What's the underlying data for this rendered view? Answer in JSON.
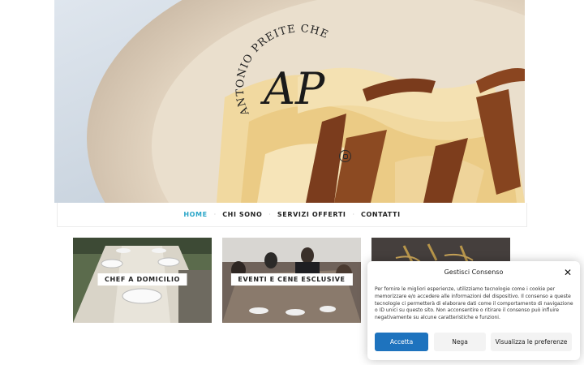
{
  "brand": {
    "logo_arc_text": "ANTONIO PREITE CHEF",
    "monogram": "AP"
  },
  "social": {
    "icon": "instagram-icon"
  },
  "nav": {
    "items": [
      {
        "label": "HOME",
        "active": true
      },
      {
        "label": "CHI SONO",
        "active": false
      },
      {
        "label": "SERVIZI OFFERTI",
        "active": false
      },
      {
        "label": "CONTATTI",
        "active": false
      }
    ],
    "separator": "·",
    "active_color": "#2aa6c8"
  },
  "cards": [
    {
      "label": "CHEF A DOMICILIO"
    },
    {
      "label": "EVENTI E CENE ESCLUSIVE"
    },
    {
      "label": ""
    }
  ],
  "cookie": {
    "title": "Gestisci Consenso",
    "close_icon": "close-icon",
    "text": "Per fornire le migliori esperienze, utilizziamo tecnologie come i cookie per memorizzare e/o accedere alle informazioni del dispositivo. Il consenso a queste tecnologie ci permetterà di elaborare dati come il comportamento di navigazione o ID unici su questo sito. Non acconsentire o ritirare il consenso può influire negativamente su alcune caratteristiche e funzioni.",
    "accept_label": "Accetta",
    "deny_label": "Nega",
    "prefs_label": "Visualizza le preferenze",
    "accent_color": "#1e73be"
  }
}
